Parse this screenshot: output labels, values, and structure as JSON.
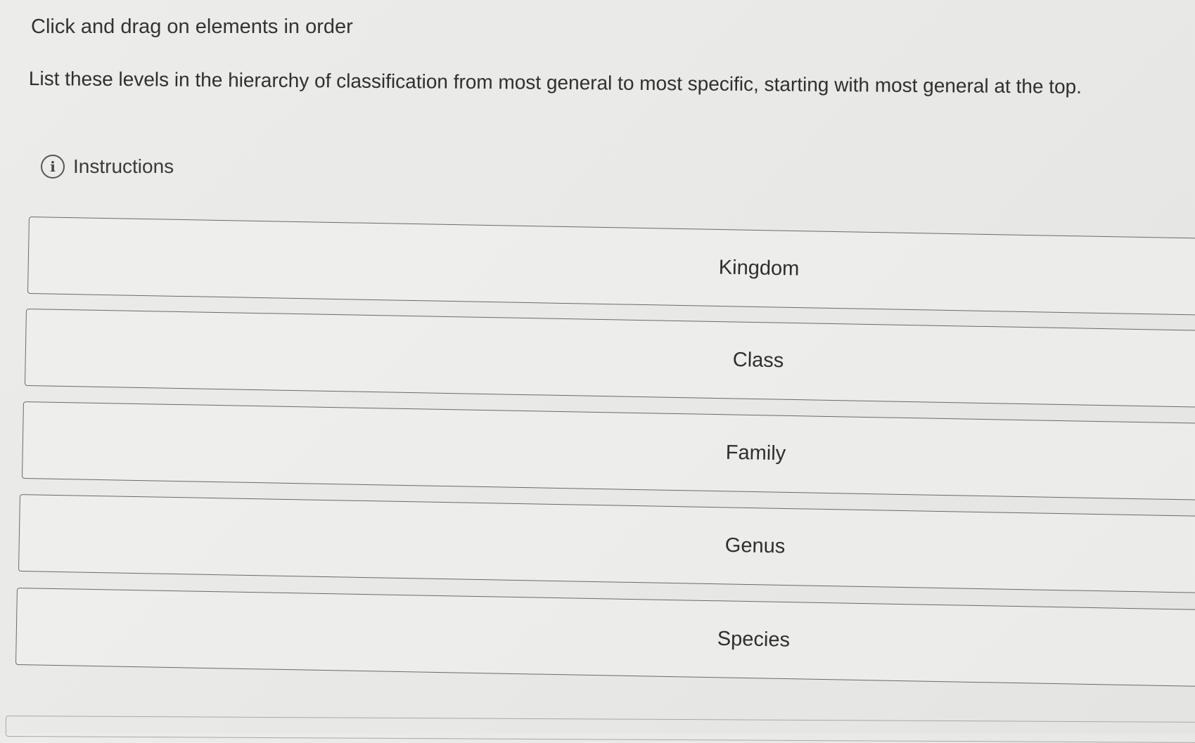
{
  "header": {
    "title": "Click and drag on elements in order"
  },
  "question": {
    "prompt": "List these levels in the hierarchy of classification from most general to most specific, starting with most general at the top."
  },
  "instructions": {
    "label": "Instructions",
    "icon": "info-icon"
  },
  "sortable_items": [
    {
      "label": "Kingdom"
    },
    {
      "label": "Class"
    },
    {
      "label": "Family"
    },
    {
      "label": "Genus"
    },
    {
      "label": "Species"
    }
  ]
}
